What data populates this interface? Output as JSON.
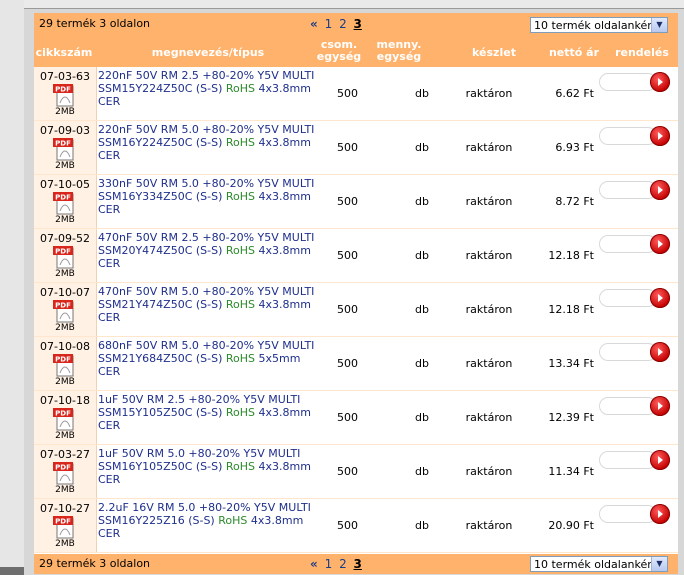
{
  "pager": {
    "count_text": "29 termék 3 oldalon",
    "first_symbol": "«",
    "pages": [
      "1",
      "2",
      "3"
    ],
    "current_page": "3",
    "per_page_value": "10 termék oldalanként"
  },
  "headers": {
    "code": "cikkszám",
    "desc": "megnevezés/típus",
    "pack_l1": "csom.",
    "pack_l2": "egység",
    "unit_l1": "menny.",
    "unit_l2": "egység",
    "stock": "készlet",
    "price": "nettó ár",
    "order": "rendelés"
  },
  "pdf_label": "PDF",
  "rows": [
    {
      "code": "07-03-63",
      "size": "2MB",
      "line1": "220nF 50V RM 2.5 +80-20% Y5V MULTI",
      "line2a": "SSM15Y224Z50C (S-S)",
      "rohs": "RoHS",
      "line2b": "4x3.8mm",
      "line3": "CER",
      "pack": "500",
      "unit": "db",
      "stock": "raktáron",
      "price": "6.62 Ft"
    },
    {
      "code": "07-09-03",
      "size": "2MB",
      "line1": "220nF 50V RM 5.0 +80-20% Y5V MULTI",
      "line2a": "SSM16Y224Z50C (S-S)",
      "rohs": "RoHS",
      "line2b": "4x3.8mm",
      "line3": "CER",
      "pack": "500",
      "unit": "db",
      "stock": "raktáron",
      "price": "6.93 Ft"
    },
    {
      "code": "07-10-05",
      "size": "2MB",
      "line1": "330nF 50V RM 5.0 +80-20% Y5V MULTI",
      "line2a": "SSM16Y334Z50C (S-S)",
      "rohs": "RoHS",
      "line2b": "4x3.8mm",
      "line3": "CER",
      "pack": "500",
      "unit": "db",
      "stock": "raktáron",
      "price": "8.72 Ft"
    },
    {
      "code": "07-09-52",
      "size": "2MB",
      "line1": "470nF 50V RM 2.5 +80-20% Y5V MULTI",
      "line2a": "SSM20Y474Z50C (S-S)",
      "rohs": "RoHS",
      "line2b": "4x3.8mm",
      "line3": "CER",
      "pack": "500",
      "unit": "db",
      "stock": "raktáron",
      "price": "12.18 Ft"
    },
    {
      "code": "07-10-07",
      "size": "2MB",
      "line1": "470nF 50V RM 5.0 +80-20% Y5V MULTI",
      "line2a": "SSM21Y474Z50C (S-S)",
      "rohs": "RoHS",
      "line2b": "4x3.8mm",
      "line3": "CER",
      "pack": "500",
      "unit": "db",
      "stock": "raktáron",
      "price": "12.18 Ft"
    },
    {
      "code": "07-10-08",
      "size": "2MB",
      "line1": "680nF 50V RM 5.0 +80-20% Y5V MULTI",
      "line2a": "SSM21Y684Z50C (S-S)",
      "rohs": "RoHS",
      "line2b": "5x5mm",
      "line3": "CER",
      "pack": "500",
      "unit": "db",
      "stock": "raktáron",
      "price": "13.34 Ft"
    },
    {
      "code": "07-10-18",
      "size": "2MB",
      "line1": "1uF 50V RM 2.5 +80-20% Y5V MULTI",
      "line2a": "SSM15Y105Z50C (S-S)",
      "rohs": "RoHS",
      "line2b": "4x3.8mm",
      "line3": "CER",
      "pack": "500",
      "unit": "db",
      "stock": "raktáron",
      "price": "12.39 Ft"
    },
    {
      "code": "07-03-27",
      "size": "2MB",
      "line1": "1uF 50V RM 5.0 +80-20% Y5V MULTI",
      "line2a": "SSM16Y105Z50C (S-S)",
      "rohs": "RoHS",
      "line2b": "4x3.8mm",
      "line3": "CER",
      "pack": "500",
      "unit": "db",
      "stock": "raktáron",
      "price": "11.34 Ft"
    },
    {
      "code": "07-10-27",
      "size": "2MB",
      "line1": "2.2uF 16V RM 5.0 +80-20% Y5V MULTI",
      "line2a": "SSM16Y225Z16 (S-S)",
      "rohs": "RoHS",
      "line2b": "4x3.8mm",
      "line3": "CER",
      "pack": "500",
      "unit": "db",
      "stock": "raktáron",
      "price": "20.90 Ft"
    }
  ],
  "colors": {
    "accent": "#ffb26b",
    "link": "#1e2f8c",
    "rohs": "#2c8a2c",
    "order_button": "#c40000"
  }
}
